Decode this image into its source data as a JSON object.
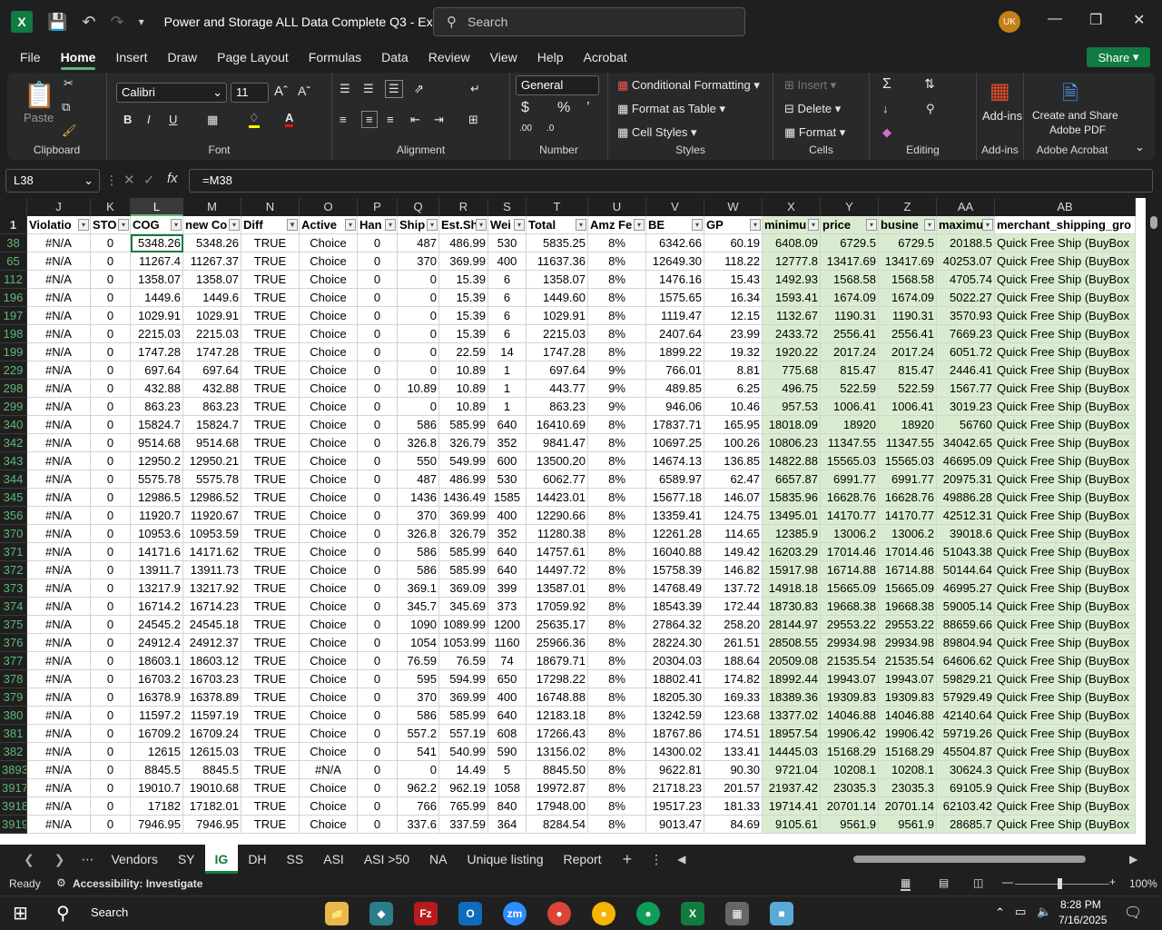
{
  "window": {
    "title": "Power and Storage ALL Data Complete Q3  -  Excel",
    "search_placeholder": "Search",
    "user_initials": "UK"
  },
  "menu": [
    "File",
    "Home",
    "Insert",
    "Draw",
    "Page Layout",
    "Formulas",
    "Data",
    "Review",
    "View",
    "Help",
    "Acrobat"
  ],
  "share_label": "Share",
  "ribbon": {
    "paste": "Paste",
    "clipboard": "Clipboard",
    "font_name": "Calibri",
    "font_size": "11",
    "font_group": "Font",
    "alignment_group": "Alignment",
    "number_format": "General",
    "number_group": "Number",
    "cond_format": "Conditional Formatting",
    "format_table": "Format as Table",
    "cell_styles": "Cell Styles",
    "styles_group": "Styles",
    "insert": "Insert",
    "delete": "Delete",
    "format": "Format",
    "cells_group": "Cells",
    "editing_group": "Editing",
    "addins": "Add-ins",
    "addins_group": "Add-ins",
    "create_share_1": "Create and Share",
    "create_share_2": "Adobe PDF",
    "acrobat_group": "Adobe Acrobat"
  },
  "namebox": "L38",
  "formula": "=M38",
  "columns": [
    "J",
    "K",
    "L",
    "M",
    "N",
    "O",
    "P",
    "Q",
    "R",
    "S",
    "T",
    "U",
    "V",
    "W",
    "X",
    "Y",
    "Z",
    "AA",
    "AB"
  ],
  "header_row": [
    "Violatio",
    "STO",
    "COG",
    "new Co",
    "Diff",
    "Active",
    "Han",
    "Ship",
    "Est.Shi",
    "Wei",
    "Total",
    "Amz Fe",
    "BE",
    "GP",
    "minimu",
    "price",
    "busine",
    "maximu",
    "merchant_shipping_gro"
  ],
  "rows": [
    [
      "38",
      "#N/A",
      "0",
      "5348.26",
      "5348.26",
      "TRUE",
      "Choice",
      "0",
      "487",
      "486.99",
      "530",
      "5835.25",
      "8%",
      "6342.66",
      "60.19",
      "6408.09",
      "6729.5",
      "6729.5",
      "20188.5",
      "Quick Free Ship (BuyBox"
    ],
    [
      "65",
      "#N/A",
      "0",
      "11267.4",
      "11267.37",
      "TRUE",
      "Choice",
      "0",
      "370",
      "369.99",
      "400",
      "11637.36",
      "8%",
      "12649.30",
      "118.22",
      "12777.8",
      "13417.69",
      "13417.69",
      "40253.07",
      "Quick Free Ship (BuyBox"
    ],
    [
      "112",
      "#N/A",
      "0",
      "1358.07",
      "1358.07",
      "TRUE",
      "Choice",
      "0",
      "0",
      "15.39",
      "6",
      "1358.07",
      "8%",
      "1476.16",
      "15.43",
      "1492.93",
      "1568.58",
      "1568.58",
      "4705.74",
      "Quick Free Ship (BuyBox"
    ],
    [
      "196",
      "#N/A",
      "0",
      "1449.6",
      "1449.6",
      "TRUE",
      "Choice",
      "0",
      "0",
      "15.39",
      "6",
      "1449.60",
      "8%",
      "1575.65",
      "16.34",
      "1593.41",
      "1674.09",
      "1674.09",
      "5022.27",
      "Quick Free Ship (BuyBox"
    ],
    [
      "197",
      "#N/A",
      "0",
      "1029.91",
      "1029.91",
      "TRUE",
      "Choice",
      "0",
      "0",
      "15.39",
      "6",
      "1029.91",
      "8%",
      "1119.47",
      "12.15",
      "1132.67",
      "1190.31",
      "1190.31",
      "3570.93",
      "Quick Free Ship (BuyBox"
    ],
    [
      "198",
      "#N/A",
      "0",
      "2215.03",
      "2215.03",
      "TRUE",
      "Choice",
      "0",
      "0",
      "15.39",
      "6",
      "2215.03",
      "8%",
      "2407.64",
      "23.99",
      "2433.72",
      "2556.41",
      "2556.41",
      "7669.23",
      "Quick Free Ship (BuyBox"
    ],
    [
      "199",
      "#N/A",
      "0",
      "1747.28",
      "1747.28",
      "TRUE",
      "Choice",
      "0",
      "0",
      "22.59",
      "14",
      "1747.28",
      "8%",
      "1899.22",
      "19.32",
      "1920.22",
      "2017.24",
      "2017.24",
      "6051.72",
      "Quick Free Ship (BuyBox"
    ],
    [
      "229",
      "#N/A",
      "0",
      "697.64",
      "697.64",
      "TRUE",
      "Choice",
      "0",
      "0",
      "10.89",
      "1",
      "697.64",
      "9%",
      "766.01",
      "8.81",
      "775.68",
      "815.47",
      "815.47",
      "2446.41",
      "Quick Free Ship (BuyBox"
    ],
    [
      "298",
      "#N/A",
      "0",
      "432.88",
      "432.88",
      "TRUE",
      "Choice",
      "0",
      "10.89",
      "10.89",
      "1",
      "443.77",
      "9%",
      "489.85",
      "6.25",
      "496.75",
      "522.59",
      "522.59",
      "1567.77",
      "Quick Free Ship (BuyBox"
    ],
    [
      "299",
      "#N/A",
      "0",
      "863.23",
      "863.23",
      "TRUE",
      "Choice",
      "0",
      "0",
      "10.89",
      "1",
      "863.23",
      "9%",
      "946.06",
      "10.46",
      "957.53",
      "1006.41",
      "1006.41",
      "3019.23",
      "Quick Free Ship (BuyBox"
    ],
    [
      "340",
      "#N/A",
      "0",
      "15824.7",
      "15824.7",
      "TRUE",
      "Choice",
      "0",
      "586",
      "585.99",
      "640",
      "16410.69",
      "8%",
      "17837.71",
      "165.95",
      "18018.09",
      "18920",
      "18920",
      "56760",
      "Quick Free Ship (BuyBox"
    ],
    [
      "342",
      "#N/A",
      "0",
      "9514.68",
      "9514.68",
      "TRUE",
      "Choice",
      "0",
      "326.8",
      "326.79",
      "352",
      "9841.47",
      "8%",
      "10697.25",
      "100.26",
      "10806.23",
      "11347.55",
      "11347.55",
      "34042.65",
      "Quick Free Ship (BuyBox"
    ],
    [
      "343",
      "#N/A",
      "0",
      "12950.2",
      "12950.21",
      "TRUE",
      "Choice",
      "0",
      "550",
      "549.99",
      "600",
      "13500.20",
      "8%",
      "14674.13",
      "136.85",
      "14822.88",
      "15565.03",
      "15565.03",
      "46695.09",
      "Quick Free Ship (BuyBox"
    ],
    [
      "344",
      "#N/A",
      "0",
      "5575.78",
      "5575.78",
      "TRUE",
      "Choice",
      "0",
      "487",
      "486.99",
      "530",
      "6062.77",
      "8%",
      "6589.97",
      "62.47",
      "6657.87",
      "6991.77",
      "6991.77",
      "20975.31",
      "Quick Free Ship (BuyBox"
    ],
    [
      "345",
      "#N/A",
      "0",
      "12986.5",
      "12986.52",
      "TRUE",
      "Choice",
      "0",
      "1436",
      "1436.49",
      "1585",
      "14423.01",
      "8%",
      "15677.18",
      "146.07",
      "15835.96",
      "16628.76",
      "16628.76",
      "49886.28",
      "Quick Free Ship (BuyBox"
    ],
    [
      "356",
      "#N/A",
      "0",
      "11920.7",
      "11920.67",
      "TRUE",
      "Choice",
      "0",
      "370",
      "369.99",
      "400",
      "12290.66",
      "8%",
      "13359.41",
      "124.75",
      "13495.01",
      "14170.77",
      "14170.77",
      "42512.31",
      "Quick Free Ship (BuyBox"
    ],
    [
      "370",
      "#N/A",
      "0",
      "10953.6",
      "10953.59",
      "TRUE",
      "Choice",
      "0",
      "326.8",
      "326.79",
      "352",
      "11280.38",
      "8%",
      "12261.28",
      "114.65",
      "12385.9",
      "13006.2",
      "13006.2",
      "39018.6",
      "Quick Free Ship (BuyBox"
    ],
    [
      "371",
      "#N/A",
      "0",
      "14171.6",
      "14171.62",
      "TRUE",
      "Choice",
      "0",
      "586",
      "585.99",
      "640",
      "14757.61",
      "8%",
      "16040.88",
      "149.42",
      "16203.29",
      "17014.46",
      "17014.46",
      "51043.38",
      "Quick Free Ship (BuyBox"
    ],
    [
      "372",
      "#N/A",
      "0",
      "13911.7",
      "13911.73",
      "TRUE",
      "Choice",
      "0",
      "586",
      "585.99",
      "640",
      "14497.72",
      "8%",
      "15758.39",
      "146.82",
      "15917.98",
      "16714.88",
      "16714.88",
      "50144.64",
      "Quick Free Ship (BuyBox"
    ],
    [
      "373",
      "#N/A",
      "0",
      "13217.9",
      "13217.92",
      "TRUE",
      "Choice",
      "0",
      "369.1",
      "369.09",
      "399",
      "13587.01",
      "8%",
      "14768.49",
      "137.72",
      "14918.18",
      "15665.09",
      "15665.09",
      "46995.27",
      "Quick Free Ship (BuyBox"
    ],
    [
      "374",
      "#N/A",
      "0",
      "16714.2",
      "16714.23",
      "TRUE",
      "Choice",
      "0",
      "345.7",
      "345.69",
      "373",
      "17059.92",
      "8%",
      "18543.39",
      "172.44",
      "18730.83",
      "19668.38",
      "19668.38",
      "59005.14",
      "Quick Free Ship (BuyBox"
    ],
    [
      "375",
      "#N/A",
      "0",
      "24545.2",
      "24545.18",
      "TRUE",
      "Choice",
      "0",
      "1090",
      "1089.99",
      "1200",
      "25635.17",
      "8%",
      "27864.32",
      "258.20",
      "28144.97",
      "29553.22",
      "29553.22",
      "88659.66",
      "Quick Free Ship (BuyBox"
    ],
    [
      "376",
      "#N/A",
      "0",
      "24912.4",
      "24912.37",
      "TRUE",
      "Choice",
      "0",
      "1054",
      "1053.99",
      "1160",
      "25966.36",
      "8%",
      "28224.30",
      "261.51",
      "28508.55",
      "29934.98",
      "29934.98",
      "89804.94",
      "Quick Free Ship (BuyBox"
    ],
    [
      "377",
      "#N/A",
      "0",
      "18603.1",
      "18603.12",
      "TRUE",
      "Choice",
      "0",
      "76.59",
      "76.59",
      "74",
      "18679.71",
      "8%",
      "20304.03",
      "188.64",
      "20509.08",
      "21535.54",
      "21535.54",
      "64606.62",
      "Quick Free Ship (BuyBox"
    ],
    [
      "378",
      "#N/A",
      "0",
      "16703.2",
      "16703.23",
      "TRUE",
      "Choice",
      "0",
      "595",
      "594.99",
      "650",
      "17298.22",
      "8%",
      "18802.41",
      "174.82",
      "18992.44",
      "19943.07",
      "19943.07",
      "59829.21",
      "Quick Free Ship (BuyBox"
    ],
    [
      "379",
      "#N/A",
      "0",
      "16378.9",
      "16378.89",
      "TRUE",
      "Choice",
      "0",
      "370",
      "369.99",
      "400",
      "16748.88",
      "8%",
      "18205.30",
      "169.33",
      "18389.36",
      "19309.83",
      "19309.83",
      "57929.49",
      "Quick Free Ship (BuyBox"
    ],
    [
      "380",
      "#N/A",
      "0",
      "11597.2",
      "11597.19",
      "TRUE",
      "Choice",
      "0",
      "586",
      "585.99",
      "640",
      "12183.18",
      "8%",
      "13242.59",
      "123.68",
      "13377.02",
      "14046.88",
      "14046.88",
      "42140.64",
      "Quick Free Ship (BuyBox"
    ],
    [
      "381",
      "#N/A",
      "0",
      "16709.2",
      "16709.24",
      "TRUE",
      "Choice",
      "0",
      "557.2",
      "557.19",
      "608",
      "17266.43",
      "8%",
      "18767.86",
      "174.51",
      "18957.54",
      "19906.42",
      "19906.42",
      "59719.26",
      "Quick Free Ship (BuyBox"
    ],
    [
      "382",
      "#N/A",
      "0",
      "12615",
      "12615.03",
      "TRUE",
      "Choice",
      "0",
      "541",
      "540.99",
      "590",
      "13156.02",
      "8%",
      "14300.02",
      "133.41",
      "14445.03",
      "15168.29",
      "15168.29",
      "45504.87",
      "Quick Free Ship (BuyBox"
    ],
    [
      "3893",
      "#N/A",
      "0",
      "8845.5",
      "8845.5",
      "TRUE",
      "#N/A",
      "0",
      "0",
      "14.49",
      "5",
      "8845.50",
      "8%",
      "9622.81",
      "90.30",
      "9721.04",
      "10208.1",
      "10208.1",
      "30624.3",
      "Quick Free Ship (BuyBox"
    ],
    [
      "3917",
      "#N/A",
      "0",
      "19010.7",
      "19010.68",
      "TRUE",
      "Choice",
      "0",
      "962.2",
      "962.19",
      "1058",
      "19972.87",
      "8%",
      "21718.23",
      "201.57",
      "21937.42",
      "23035.3",
      "23035.3",
      "69105.9",
      "Quick Free Ship (BuyBox"
    ],
    [
      "3918",
      "#N/A",
      "0",
      "17182",
      "17182.01",
      "TRUE",
      "Choice",
      "0",
      "766",
      "765.99",
      "840",
      "17948.00",
      "8%",
      "19517.23",
      "181.33",
      "19714.41",
      "20701.14",
      "20701.14",
      "62103.42",
      "Quick Free Ship (BuyBox"
    ],
    [
      "3919",
      "#N/A",
      "0",
      "7946.95",
      "7946.95",
      "TRUE",
      "Choice",
      "0",
      "337.6",
      "337.59",
      "364",
      "8284.54",
      "8%",
      "9013.47",
      "84.69",
      "9105.61",
      "9561.9",
      "9561.9",
      "28685.7",
      "Quick Free Ship (BuyBox"
    ]
  ],
  "sheets": [
    "Vendors",
    "SY",
    "IG",
    "DH",
    "SS",
    "ASI",
    "ASI >50",
    "NA",
    "Unique listing",
    "Report"
  ],
  "active_sheet": "IG",
  "status": {
    "ready": "Ready",
    "accessibility": "Accessibility: Investigate",
    "zoom": "100%"
  },
  "taskbar": {
    "search": "Search",
    "time": "8:28 PM",
    "date": "7/16/2025"
  }
}
